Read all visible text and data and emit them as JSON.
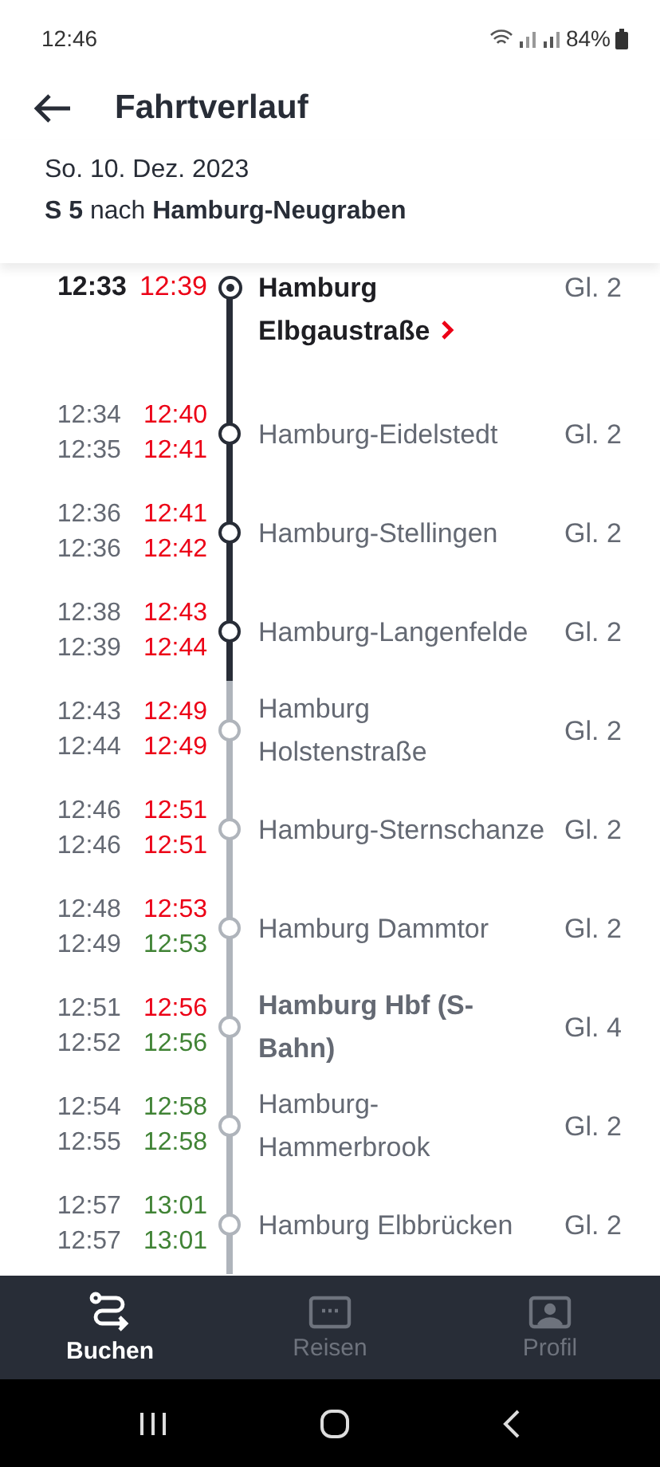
{
  "status_bar": {
    "time": "12:46",
    "battery": "84%"
  },
  "header": {
    "title": "Fahrtverlauf"
  },
  "trip": {
    "date": "So. 10. Dez. 2023",
    "line": "S 5",
    "connector": "nach",
    "destination": "Hamburg-Neugraben"
  },
  "stops": [
    {
      "kind": "origin",
      "name": "Hamburg Elbgaustraße",
      "platform": "Gl. 2",
      "passed": true,
      "major": true,
      "times": [
        {
          "planned": "12:33",
          "actual": "12:39",
          "delayed": true
        }
      ]
    },
    {
      "kind": "stop",
      "name": "Hamburg-Eidelstedt",
      "platform": "Gl. 2",
      "passed": true,
      "major": false,
      "times": [
        {
          "planned": "12:34",
          "actual": "12:40",
          "delayed": true
        },
        {
          "planned": "12:35",
          "actual": "12:41",
          "delayed": true
        }
      ]
    },
    {
      "kind": "stop",
      "name": "Hamburg-Stellingen",
      "platform": "Gl. 2",
      "passed": true,
      "major": false,
      "times": [
        {
          "planned": "12:36",
          "actual": "12:41",
          "delayed": true
        },
        {
          "planned": "12:36",
          "actual": "12:42",
          "delayed": true
        }
      ]
    },
    {
      "kind": "stop",
      "name": "Hamburg-Langenfelde",
      "platform": "Gl. 2",
      "passed": true,
      "major": false,
      "times": [
        {
          "planned": "12:38",
          "actual": "12:43",
          "delayed": true
        },
        {
          "planned": "12:39",
          "actual": "12:44",
          "delayed": true
        }
      ]
    },
    {
      "kind": "stop",
      "name": "Hamburg Holstenstraße",
      "platform": "Gl. 2",
      "passed": false,
      "major": false,
      "times": [
        {
          "planned": "12:43",
          "actual": "12:49",
          "delayed": true
        },
        {
          "planned": "12:44",
          "actual": "12:49",
          "delayed": true
        }
      ]
    },
    {
      "kind": "stop",
      "name": "Hamburg-Sternschanze",
      "platform": "Gl. 2",
      "passed": false,
      "major": false,
      "times": [
        {
          "planned": "12:46",
          "actual": "12:51",
          "delayed": true
        },
        {
          "planned": "12:46",
          "actual": "12:51",
          "delayed": true
        }
      ]
    },
    {
      "kind": "stop",
      "name": "Hamburg Dammtor",
      "platform": "Gl. 2",
      "passed": false,
      "major": false,
      "times": [
        {
          "planned": "12:48",
          "actual": "12:53",
          "delayed": true
        },
        {
          "planned": "12:49",
          "actual": "12:53",
          "delayed": false
        }
      ]
    },
    {
      "kind": "stop",
      "name": "Hamburg Hbf (S-Bahn)",
      "platform": "Gl. 4",
      "passed": false,
      "major": true,
      "times": [
        {
          "planned": "12:51",
          "actual": "12:56",
          "delayed": true
        },
        {
          "planned": "12:52",
          "actual": "12:56",
          "delayed": false
        }
      ]
    },
    {
      "kind": "stop",
      "name": "Hamburg-Hammerbrook",
      "platform": "Gl. 2",
      "passed": false,
      "major": false,
      "times": [
        {
          "planned": "12:54",
          "actual": "12:58",
          "delayed": false
        },
        {
          "planned": "12:55",
          "actual": "12:58",
          "delayed": false
        }
      ]
    },
    {
      "kind": "stop",
      "name": "Hamburg Elbbrücken",
      "platform": "Gl. 2",
      "passed": false,
      "major": false,
      "times": [
        {
          "planned": "12:57",
          "actual": "13:01",
          "delayed": false
        },
        {
          "planned": "12:57",
          "actual": "13:01",
          "delayed": false
        }
      ]
    }
  ],
  "nav": [
    {
      "kind": "route",
      "label": "Buchen",
      "selected": true
    },
    {
      "kind": "ticket",
      "label": "Reisen",
      "selected": false
    },
    {
      "kind": "profile",
      "label": "Profil",
      "selected": false
    }
  ]
}
